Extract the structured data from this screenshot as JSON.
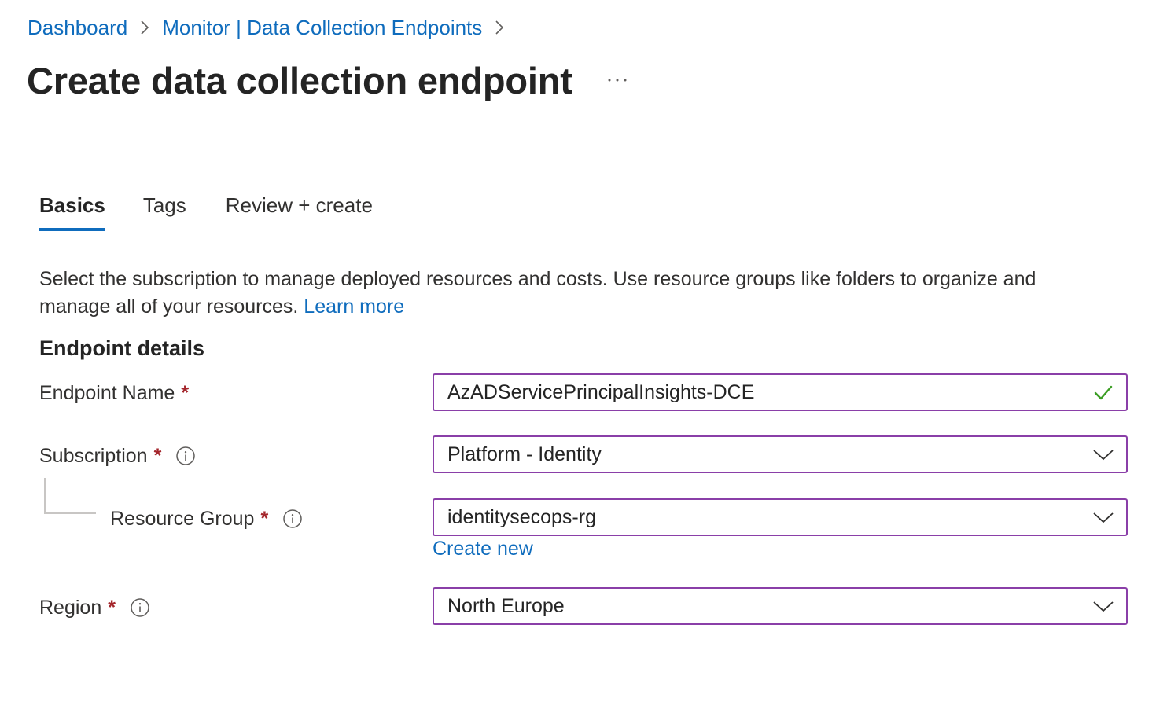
{
  "breadcrumb": {
    "items": [
      "Dashboard",
      "Monitor | Data Collection Endpoints"
    ]
  },
  "page": {
    "title": "Create data collection endpoint",
    "more_icon": "ellipsis-icon"
  },
  "tabs": [
    {
      "label": "Basics",
      "active": true
    },
    {
      "label": "Tags",
      "active": false
    },
    {
      "label": "Review + create",
      "active": false
    }
  ],
  "description": {
    "text": "Select the subscription to manage deployed resources and costs. Use resource groups like folders to organize and manage all of your resources.",
    "link": "Learn more"
  },
  "section": {
    "heading": "Endpoint details"
  },
  "form": {
    "required_marker": "*",
    "endpoint_name": {
      "label": "Endpoint Name",
      "value": "AzADServicePrincipalInsights-DCE",
      "status_icon": "checkmark-icon"
    },
    "subscription": {
      "label": "Subscription",
      "value": "Platform - Identity"
    },
    "resource_group": {
      "label": "Resource Group",
      "value": "identitysecops-rg",
      "create_new": "Create new"
    },
    "region": {
      "label": "Region",
      "value": "North Europe"
    }
  },
  "colors": {
    "link": "#0f6cbd",
    "required": "#a4262c",
    "field_border": "#8a3fa8",
    "valid_check": "#3a9d23",
    "tab_underline": "#0f6cbd"
  }
}
